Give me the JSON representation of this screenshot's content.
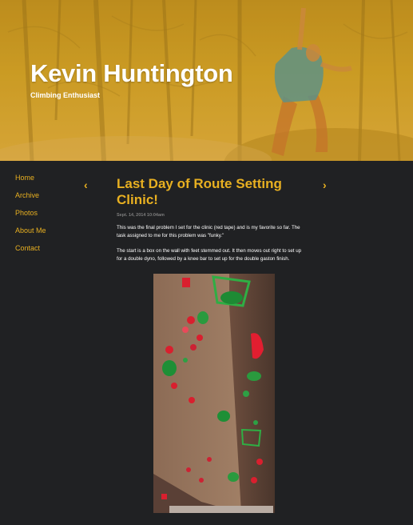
{
  "header": {
    "title": "Kevin Huntington",
    "tagline": "Climbing Enthusiast"
  },
  "nav": {
    "items": [
      {
        "label": "Home"
      },
      {
        "label": "Archive"
      },
      {
        "label": "Photos"
      },
      {
        "label": "About Me"
      },
      {
        "label": "Contact"
      }
    ]
  },
  "post": {
    "prev_icon": "chevron-left-icon",
    "next_icon": "chevron-right-icon",
    "prev_glyph": "‹",
    "next_glyph": "›",
    "title": "Last Day of Route Setting Clinic!",
    "date": "Sept. 14, 2014 10:04am",
    "paragraphs": [
      "This was the final problem I set for the clinic (red tape) and is my favorite so far. The task assigned to me for this problem was \"funky.\"",
      "The start is a box on the wall with feet stemmed out. It then moves out right to set up for a double dyno, followed by a knee bar to set up for the double gaston finish."
    ]
  },
  "colors": {
    "accent": "#e8b021",
    "background": "#202123",
    "header_gold": "#c99a22",
    "text": "#ffffff",
    "muted": "#7d7d7d"
  }
}
